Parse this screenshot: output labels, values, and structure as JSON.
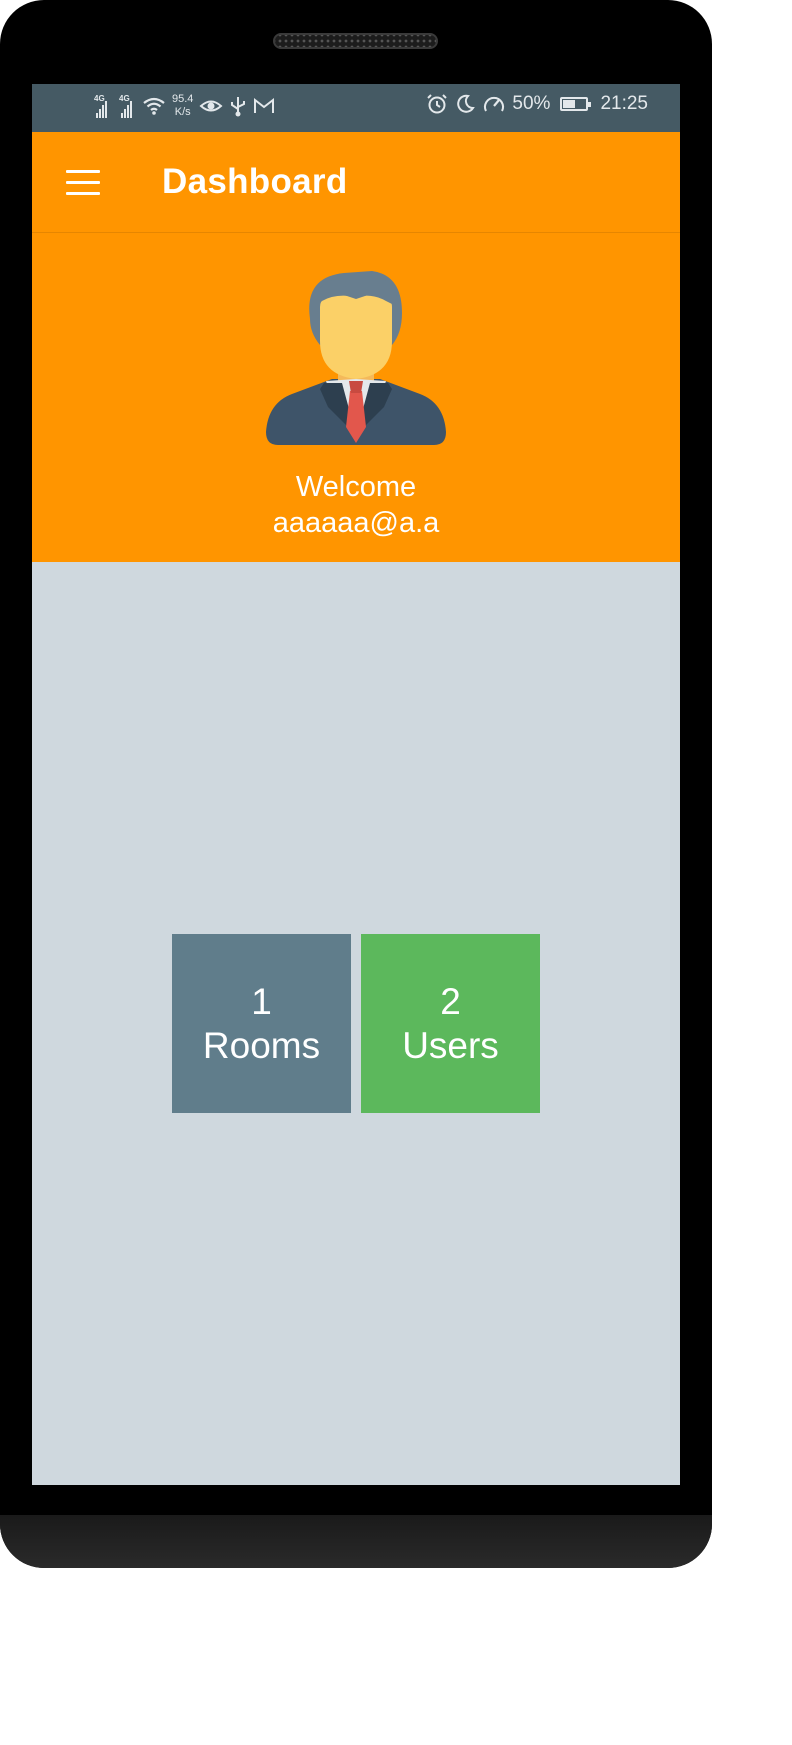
{
  "statusbar": {
    "net1": "4G",
    "net2": "4G",
    "speed_value": "95.4",
    "speed_unit": "K/s",
    "battery": "50%",
    "time": "21:25",
    "icons": [
      "signal-icon",
      "signal-icon",
      "wifi-icon",
      "eye-icon",
      "usb-icon",
      "gmail-icon",
      "alarm-icon",
      "moon-icon",
      "speedometer-icon",
      "battery-icon"
    ]
  },
  "toolbar": {
    "title": "Dashboard",
    "menu_icon": "hamburger-menu-icon"
  },
  "header": {
    "welcome": "Welcome",
    "email": "aaaaaa@a.a",
    "avatar_icon": "businessman-avatar-icon"
  },
  "tiles": [
    {
      "count": "1",
      "label": "Rooms",
      "color": "#607d8b"
    },
    {
      "count": "2",
      "label": "Users",
      "color": "#5cb85c"
    }
  ],
  "colors": {
    "accent": "#ff9500",
    "statusbar": "#455a64",
    "background": "#cfd8de"
  }
}
